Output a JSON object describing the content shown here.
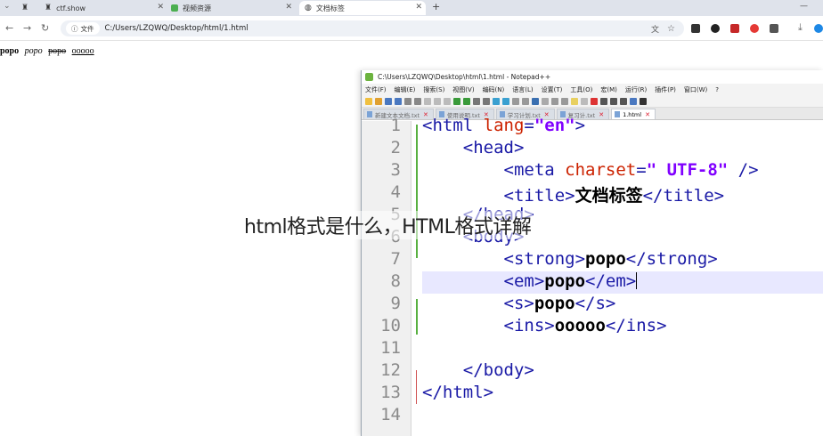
{
  "browser": {
    "tabs": [
      {
        "label": "",
        "icon": "person-icon"
      },
      {
        "label": "ctf.show",
        "icon": "person-icon"
      },
      {
        "label": "视频资源",
        "icon": "video-icon"
      },
      {
        "label": "文档标签",
        "icon": "globe-icon"
      }
    ],
    "new_tab": "+",
    "site_chip": "文件",
    "url": "C:/Users/LZQWQ/Desktop/html/1.html"
  },
  "page": {
    "strong": "popo",
    "em": "popo",
    "s": "popo",
    "ins": "ooooo"
  },
  "npp": {
    "title": "C:\\Users\\LZQWQ\\Desktop\\html\\1.html - Notepad++",
    "menu": [
      "文件(F)",
      "编辑(E)",
      "搜索(S)",
      "视图(V)",
      "编码(N)",
      "语言(L)",
      "设置(T)",
      "工具(O)",
      "宏(M)",
      "运行(R)",
      "插件(P)",
      "窗口(W)",
      "?"
    ],
    "file_tabs": [
      "新建文本文档.txt",
      "使用说明.txt",
      "学习计划.txt",
      "复习计.txt",
      "1.html"
    ],
    "active_file_tab": "1.html",
    "lines": [
      {
        "n": "1",
        "parts": [
          [
            "t",
            "<html "
          ],
          [
            "a",
            "lang"
          ],
          [
            "t",
            "="
          ],
          [
            "v",
            "\"en\""
          ],
          [
            "t",
            ">"
          ]
        ]
      },
      {
        "n": "2",
        "parts": [
          [
            "",
            "    "
          ],
          [
            "t",
            "<head>"
          ]
        ]
      },
      {
        "n": "3",
        "parts": [
          [
            "",
            "        "
          ],
          [
            "t",
            "<meta "
          ],
          [
            "a",
            "charset"
          ],
          [
            "t",
            "="
          ],
          [
            "v",
            "\" UTF-8\""
          ],
          [
            "t",
            " />"
          ]
        ]
      },
      {
        "n": "4",
        "parts": [
          [
            "",
            "        "
          ],
          [
            "t",
            "<title>"
          ],
          [
            "w",
            "文档标签"
          ],
          [
            "t",
            "</title>"
          ]
        ]
      },
      {
        "n": "5",
        "parts": [
          [
            "",
            "    "
          ],
          [
            "t",
            "</head>"
          ]
        ]
      },
      {
        "n": "6",
        "parts": [
          [
            "",
            "    "
          ],
          [
            "t",
            "<body>"
          ]
        ]
      },
      {
        "n": "7",
        "parts": [
          [
            "",
            "        "
          ],
          [
            "t",
            "<strong>"
          ],
          [
            "w",
            "popo"
          ],
          [
            "t",
            "</strong>"
          ]
        ]
      },
      {
        "n": "8",
        "parts": [
          [
            "",
            "        "
          ],
          [
            "t",
            "<em>"
          ],
          [
            "w",
            "popo"
          ],
          [
            "t",
            "</em>"
          ]
        ]
      },
      {
        "n": "9",
        "parts": [
          [
            "",
            "        "
          ],
          [
            "t",
            "<s>"
          ],
          [
            "w",
            "popo"
          ],
          [
            "t",
            "</s>"
          ]
        ]
      },
      {
        "n": "10",
        "parts": [
          [
            "",
            "        "
          ],
          [
            "t",
            "<ins>"
          ],
          [
            "w",
            "ooooo"
          ],
          [
            "t",
            "</ins>"
          ]
        ]
      },
      {
        "n": "11",
        "parts": []
      },
      {
        "n": "12",
        "parts": [
          [
            "",
            "    "
          ],
          [
            "t",
            "</body>"
          ]
        ]
      },
      {
        "n": "13",
        "parts": [
          [
            "t",
            "</html>"
          ]
        ]
      },
      {
        "n": "14",
        "parts": []
      }
    ],
    "current_line": 8
  },
  "watermark": "html格式是什么，HTML格式详解"
}
